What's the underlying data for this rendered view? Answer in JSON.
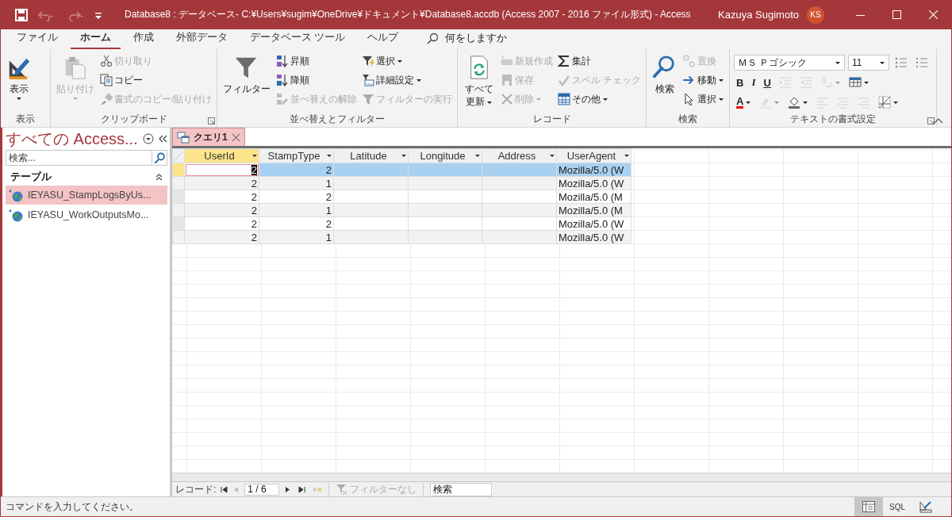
{
  "title_bar": {
    "title": "Database8 : データベース- C:¥Users¥sugim¥OneDrive¥ドキュメント¥Database8.accdb (Access 2007 - 2016 ファイル形式)  -  Access",
    "user": "Kazuya Sugimoto",
    "initials": "KS",
    "quick_access": [
      {
        "disabled": false
      },
      {
        "disabled": true
      },
      {
        "disabled": true
      }
    ]
  },
  "ribbon_tabs": [
    {
      "label": "ファイル",
      "selected": false
    },
    {
      "label": "ホーム",
      "selected": true
    },
    {
      "label": "作成",
      "selected": false
    },
    {
      "label": "外部データ",
      "selected": false
    },
    {
      "label": "データベース ツール",
      "selected": false
    },
    {
      "label": "ヘルプ",
      "selected": false
    }
  ],
  "tell_me": "何をしますか",
  "ribbon_groups": [
    {
      "label": "表示",
      "columns": [
        [
          {
            "kind": "large",
            "label": "表示",
            "dropdown": true,
            "disabled": false
          }
        ]
      ]
    },
    {
      "label": "クリップボード",
      "launcher": true,
      "columns": [
        [
          {
            "kind": "large",
            "label": "貼り付け",
            "dropdown": true,
            "disabled": true
          }
        ],
        [
          {
            "kind": "small",
            "label": "切り取り",
            "dropdown": false,
            "disabled": true
          },
          {
            "kind": "small",
            "label": "コピー",
            "dropdown": false,
            "disabled": false
          },
          {
            "kind": "small",
            "label": "書式のコピー/貼り付け",
            "dropdown": false,
            "disabled": true
          }
        ]
      ]
    },
    {
      "label": "並べ替えとフィルター",
      "columns": [
        [
          {
            "kind": "large",
            "label": "フィルター",
            "dropdown": false,
            "disabled": false
          }
        ],
        [
          {
            "kind": "small",
            "label": "昇順",
            "dropdown": false,
            "disabled": false
          },
          {
            "kind": "small",
            "label": "降順",
            "dropdown": false,
            "disabled": false
          },
          {
            "kind": "small",
            "label": "並べ替えの解除",
            "dropdown": false,
            "disabled": true
          }
        ],
        [
          {
            "kind": "small",
            "label": "選択",
            "dropdown": true,
            "disabled": false
          },
          {
            "kind": "small",
            "label": "詳細設定",
            "dropdown": true,
            "disabled": false
          },
          {
            "kind": "small",
            "label": "フィルターの実行",
            "dropdown": false,
            "disabled": true
          }
        ]
      ]
    },
    {
      "label": "レコード",
      "columns": [
        [
          {
            "kind": "large",
            "label": "すべて更新",
            "dropdown": true,
            "disabled": false
          }
        ],
        [
          {
            "kind": "small",
            "label": "新規作成",
            "dropdown": false,
            "disabled": true
          },
          {
            "kind": "small",
            "label": "保存",
            "dropdown": false,
            "disabled": true
          },
          {
            "kind": "small",
            "label": "削除",
            "dropdown": true,
            "disabled": true
          }
        ],
        [
          {
            "kind": "small",
            "label": "集計",
            "dropdown": false,
            "disabled": false
          },
          {
            "kind": "small",
            "label": "スペル チェック",
            "dropdown": false,
            "disabled": true
          },
          {
            "kind": "small",
            "label": "その他",
            "dropdown": true,
            "disabled": false
          }
        ]
      ]
    },
    {
      "label": "検索",
      "columns": [
        [
          {
            "kind": "large",
            "label": "検索",
            "dropdown": false,
            "disabled": false
          }
        ],
        [
          {
            "kind": "small",
            "label": "置換",
            "dropdown": false,
            "disabled": true
          },
          {
            "kind": "small",
            "label": "移動",
            "dropdown": true,
            "disabled": false
          },
          {
            "kind": "small",
            "label": "選択",
            "dropdown": true,
            "disabled": false
          }
        ]
      ]
    },
    {
      "label": "テキストの書式設定",
      "launcher": true,
      "rows": [
        [
          {
            "kind": "combo",
            "value": "ＭＳ Ｐゴシック"
          },
          {
            "kind": "combo",
            "value": "11"
          },
          {
            "kind": "icon",
            "dropdown": false,
            "disabled": false
          },
          {
            "kind": "icon",
            "dropdown": false,
            "disabled": false
          }
        ],
        [
          {
            "kind": "glyph",
            "label": "B",
            "dropdown": false,
            "disabled": false
          },
          {
            "kind": "glyph",
            "label": "I",
            "dropdown": false,
            "disabled": false
          },
          {
            "kind": "glyph",
            "label": "U",
            "dropdown": false,
            "disabled": false
          },
          {
            "kind": "icon",
            "dropdown": false,
            "disabled": true
          },
          {
            "kind": "icon",
            "dropdown": false,
            "disabled": true
          },
          {
            "kind": "icon",
            "dropdown": true,
            "disabled": true
          },
          {
            "kind": "icon",
            "dropdown": true,
            "disabled": false
          }
        ],
        [
          {
            "kind": "glyph",
            "label": "A",
            "dropdown": true,
            "disabled": false
          },
          {
            "kind": "icon",
            "dropdown": true,
            "disabled": true
          },
          {
            "kind": "icon",
            "dropdown": true,
            "disabled": false
          },
          {
            "kind": "icon",
            "dropdown": false,
            "disabled": true
          },
          {
            "kind": "icon",
            "dropdown": false,
            "disabled": true
          },
          {
            "kind": "icon",
            "dropdown": false,
            "disabled": true
          },
          {
            "kind": "icon",
            "dropdown": true,
            "disabled": false
          }
        ]
      ]
    }
  ],
  "navigation_pane": {
    "title": "すべての Access...",
    "search_placeholder": "検索...",
    "sections": [
      {
        "label": "テーブル",
        "expanded": true,
        "items": [
          {
            "label": "IEYASU_StampLogsByUs...",
            "selected": true
          },
          {
            "label": "IEYASU_WorkOutputsMo...",
            "selected": false
          }
        ]
      }
    ]
  },
  "document_tabs": [
    {
      "label": "クエリ1",
      "selected": true
    }
  ],
  "datasheet": {
    "columns": [
      {
        "label": "UserId",
        "selected": true
      },
      {
        "label": "StampType",
        "selected": false
      },
      {
        "label": "Latitude",
        "selected": false
      },
      {
        "label": "Longitude",
        "selected": false
      },
      {
        "label": "Address",
        "selected": false
      },
      {
        "label": "UserAgent",
        "selected": false
      }
    ],
    "rows": [
      {
        "cells": [
          "2",
          "2",
          null,
          null,
          null,
          "Mozilla/5.0 (W"
        ],
        "selected": true
      },
      {
        "cells": [
          "2",
          "1",
          null,
          null,
          null,
          "Mozilla/5.0 (W"
        ],
        "selected": false
      },
      {
        "cells": [
          "2",
          "2",
          null,
          null,
          null,
          "Mozilla/5.0 (M"
        ],
        "selected": false
      },
      {
        "cells": [
          "2",
          "1",
          null,
          null,
          null,
          "Mozilla/5.0 (M"
        ],
        "selected": false
      },
      {
        "cells": [
          "2",
          "2",
          null,
          null,
          null,
          "Mozilla/5.0 (W"
        ],
        "selected": false
      },
      {
        "cells": [
          "2",
          "1",
          null,
          null,
          null,
          "Mozilla/5.0 (W"
        ],
        "selected": false
      }
    ]
  },
  "record_nav": {
    "label": "レコード:",
    "position": "1 / 6",
    "filter": "フィルターなし",
    "search_placeholder": "検索"
  },
  "status_bar": {
    "message": "コマンドを入力してください。",
    "views": [
      {
        "kind": "datasheet",
        "selected": true
      },
      {
        "kind": "sql",
        "label": "SQL",
        "selected": false
      },
      {
        "kind": "design",
        "selected": false
      }
    ]
  }
}
